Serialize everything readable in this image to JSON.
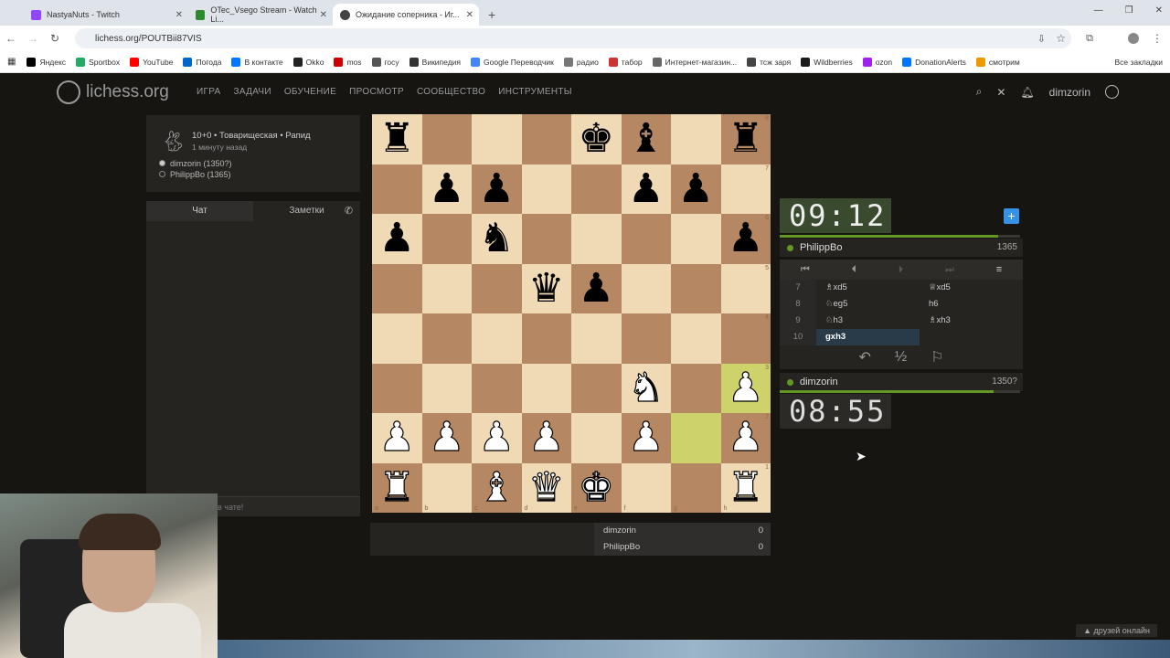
{
  "browser": {
    "tabs": [
      {
        "title": "NastyaNuts - Twitch"
      },
      {
        "title": "OTec_Vsego Stream - Watch Li..."
      },
      {
        "title": "Ожидание соперника - Иг..."
      }
    ],
    "url": "lichess.org/POUTBii87VIS",
    "bookmarks": [
      "Яндекс",
      "Sportbox",
      "YouTube",
      "Погода",
      "В контакте",
      "Okko",
      "mos",
      "госу",
      "Википедия",
      "Google Переводчик",
      "радио",
      "табор",
      "Интернет-магазин...",
      "тсж заря",
      "Wildberries",
      "ozon",
      "DonationAlerts",
      "смотрим"
    ],
    "all_bookmarks": "Все закладки"
  },
  "site": {
    "logo": "lichess.org",
    "nav": [
      "ИГРА",
      "ЗАДАЧИ",
      "ОБУЧЕНИЕ",
      "ПРОСМОТР",
      "СООБЩЕСТВО",
      "ИНСТРУМЕНТЫ"
    ],
    "user": "dimzorin"
  },
  "game": {
    "meta_line1": "10+0 • Товарищеская • Рапид",
    "meta_line2": "1 минуту назад",
    "white": "dimzorin (1350?)",
    "black": "PhilippBo (1365)"
  },
  "chat": {
    "tab_chat": "Чат",
    "tab_notes": "Заметки",
    "footer": "в чате!"
  },
  "board": {
    "rows": [
      [
        "br",
        "",
        "",
        "",
        "bk",
        "bb",
        "",
        "br"
      ],
      [
        "",
        "bp",
        "bp",
        "",
        "",
        "bp",
        "bp",
        ""
      ],
      [
        "bp",
        "",
        "bn",
        "",
        "",
        "",
        "",
        "bp"
      ],
      [
        "",
        "",
        "",
        "bq",
        "bp",
        "",
        "",
        ""
      ],
      [
        "",
        "",
        "",
        "",
        "",
        "",
        "",
        ""
      ],
      [
        "",
        "",
        "",
        "",
        "",
        "wn",
        "",
        "wp"
      ],
      [
        "wp",
        "wp",
        "wp",
        "wp",
        "",
        "wp",
        "",
        "wp"
      ],
      [
        "wr",
        "",
        "wb",
        "wq",
        "wk",
        "",
        "",
        "wr"
      ]
    ],
    "highlight": [
      [
        5,
        7
      ],
      [
        6,
        6
      ]
    ],
    "files": [
      "a",
      "b",
      "c",
      "d",
      "e",
      "f",
      "g",
      "h"
    ],
    "ranks": [
      "8",
      "7",
      "6",
      "5",
      "4",
      "3",
      "2",
      "1"
    ]
  },
  "score": {
    "p1": "dimzorin",
    "p1_score": "0",
    "p2": "PhilippBo",
    "p2_score": "0"
  },
  "clocks": {
    "top": "09:12",
    "top_player": "PhilippBo",
    "top_rating": "1365",
    "top_progress": 0.91,
    "bottom": "08:55",
    "bottom_player": "dimzorin",
    "bottom_rating": "1350?",
    "bottom_progress": 0.89
  },
  "moves": [
    {
      "n": "7",
      "w": "♗xd5",
      "b": "♕xd5"
    },
    {
      "n": "8",
      "w": "♘eg5",
      "b": "h6"
    },
    {
      "n": "9",
      "w": "♘h3",
      "b": "♗xh3"
    },
    {
      "n": "10",
      "w": "gxh3",
      "b": ""
    }
  ],
  "friends": "друзей онлайн"
}
